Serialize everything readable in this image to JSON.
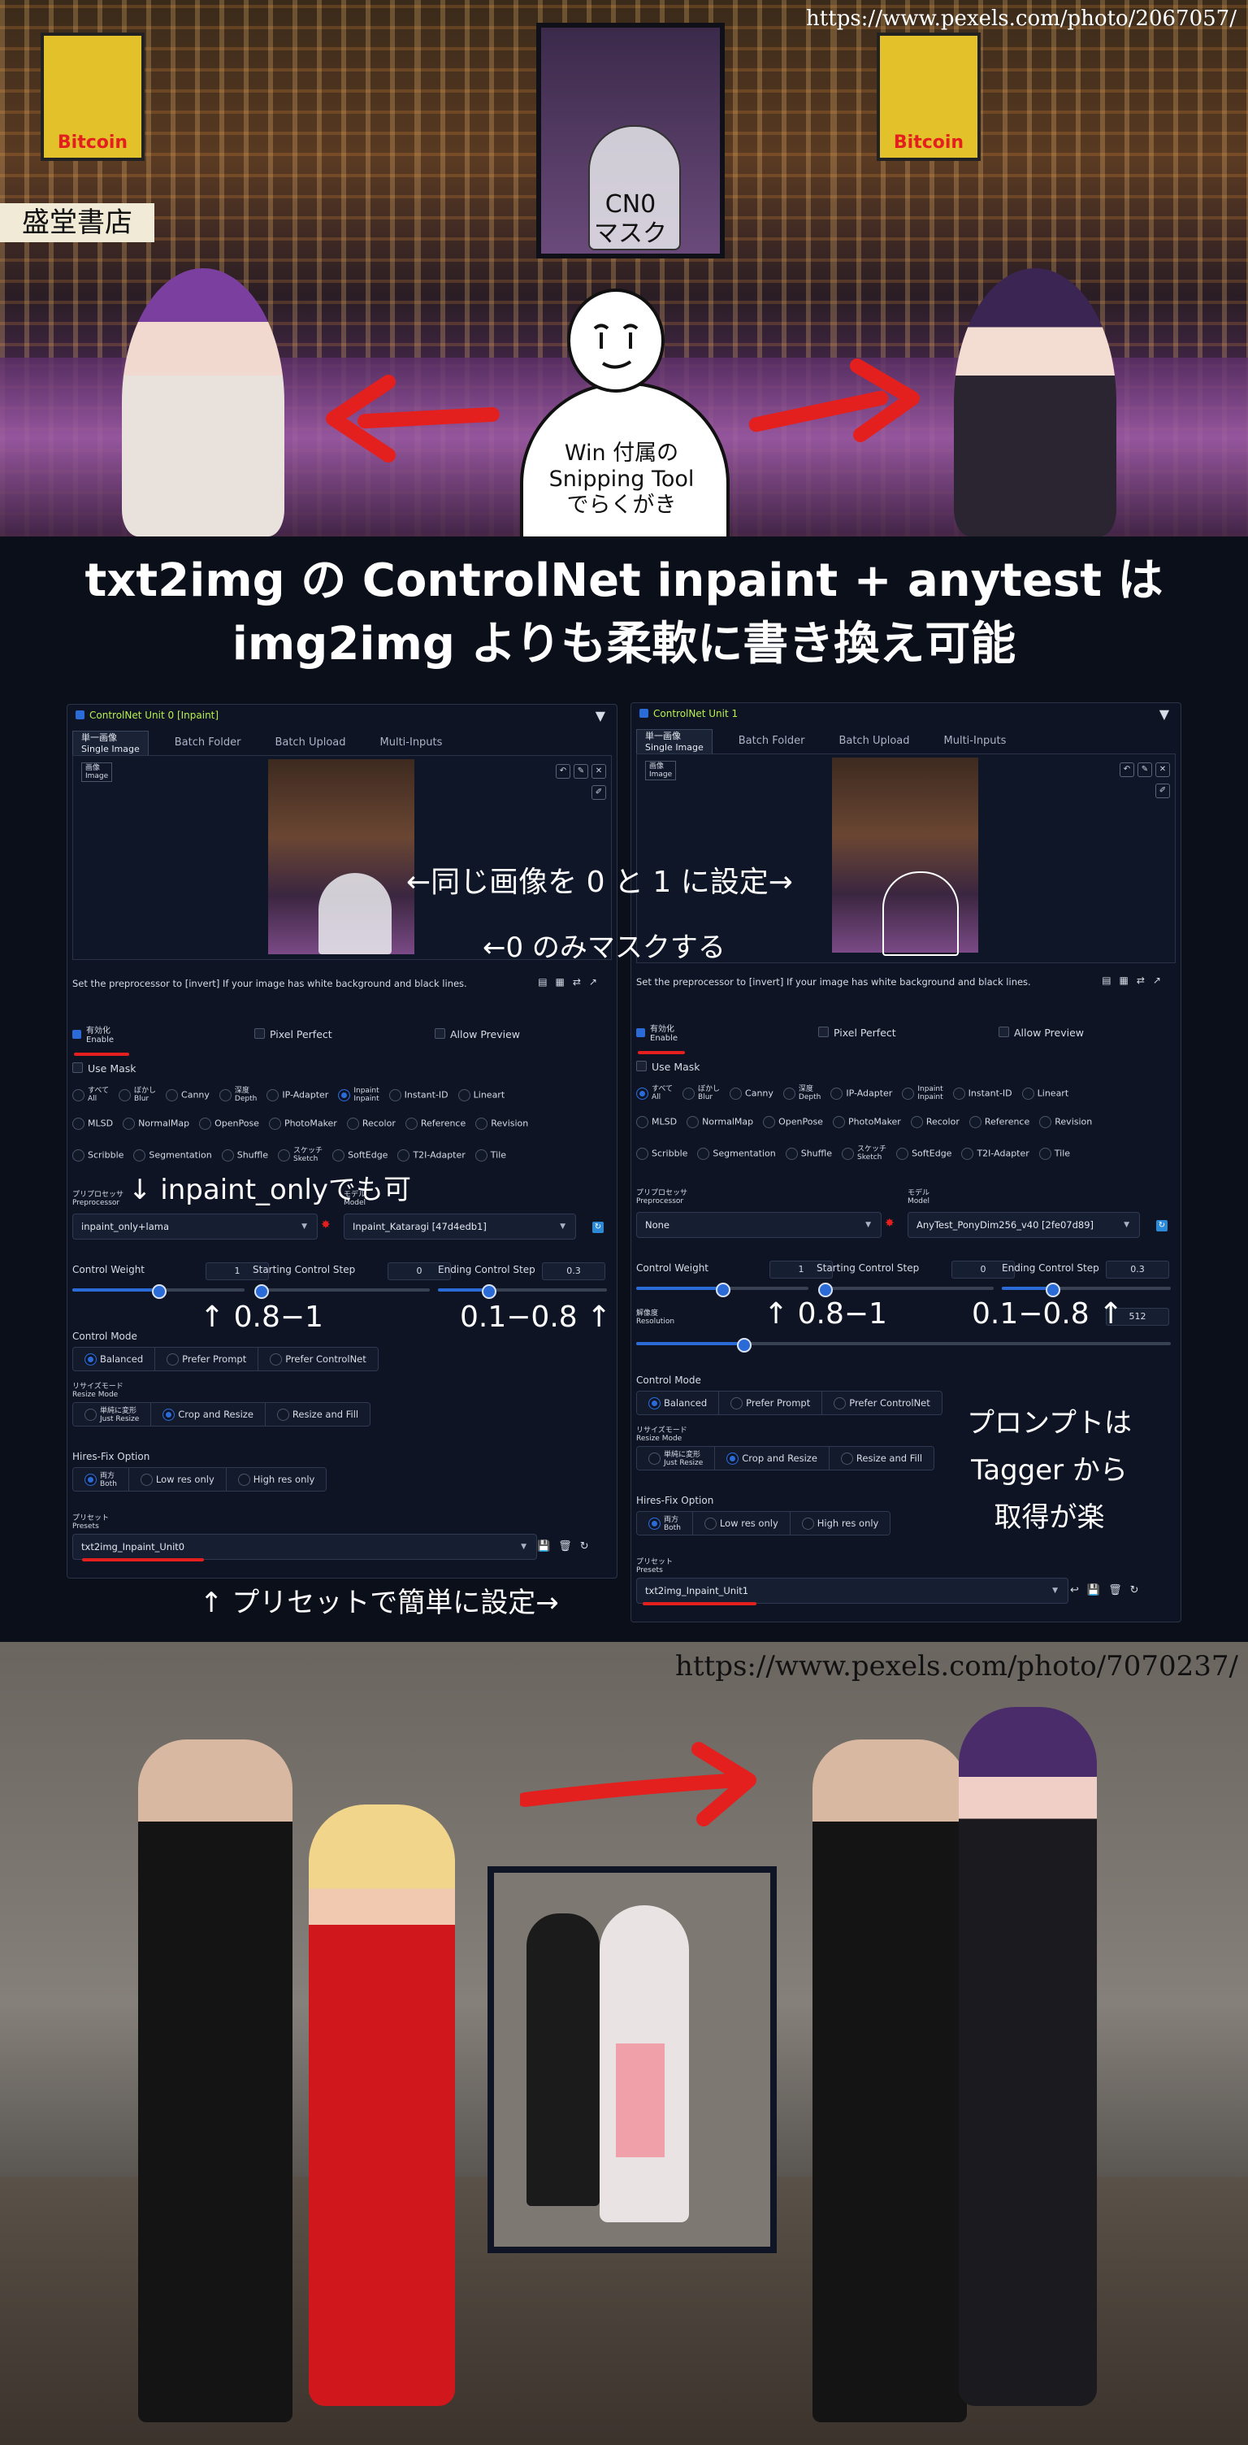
{
  "top_photo": {
    "source_url": "https://www.pexels.com/photo/2067057/",
    "billboard_text": "Bitcoin",
    "sign_text": "盛堂書店",
    "mask_label": "CN0\nマスク",
    "doodle_caption": "Win 付属の\nSnipping Tool\nでらくがき"
  },
  "title": {
    "line1": "txt2img の ControlNet inpaint + anytest は",
    "line2": "img2img よりも柔軟に書き換え可能"
  },
  "unit0": {
    "header": "ControlNet Unit 0 [Inpaint]",
    "tabs": [
      "単一画像\nSingle Image",
      "Batch Folder",
      "Batch Upload",
      "Multi-Inputs"
    ],
    "image_label": "画像\nImage",
    "hint": "Set the preprocessor to [invert] If your image has white background and black lines.",
    "enable": "有効化\nEnable",
    "pixel_perfect": "Pixel Perfect",
    "allow_preview": "Allow Preview",
    "use_mask": "Use Mask",
    "control_types_row1": [
      "すべて\nAll",
      "ぼかし\nBlur",
      "Canny",
      "深度\nDepth",
      "IP-Adapter",
      "Inpaint\nInpaint",
      "Instant-ID",
      "Lineart"
    ],
    "control_types_row2": [
      "MLSD",
      "NormalMap",
      "OpenPose",
      "PhotoMaker",
      "Recolor",
      "Reference",
      "Revision"
    ],
    "control_types_row3": [
      "Scribble",
      "Segmentation",
      "Shuffle",
      "スケッチ\nSketch",
      "SoftEdge",
      "T2I-Adapter",
      "Tile"
    ],
    "selected_type": "Inpaint\nInpaint",
    "preprocessor_label": "プリプロセッサ\nPreprocessor",
    "preprocessor": "inpaint_only+lama",
    "model_label": "モデル\nModel",
    "model": "Inpaint_Kataragi [47d4edb1]",
    "control_weight_label": "Control Weight",
    "control_weight": "1",
    "start_step_label": "Starting Control Step",
    "start_step": "0",
    "end_step_label": "Ending Control Step",
    "end_step": "0.3",
    "weight_fill": 0.5,
    "start_fill": 0.0,
    "end_fill": 0.3,
    "control_mode_label": "Control Mode",
    "control_modes": [
      "Balanced",
      "Prefer Prompt",
      "Prefer ControlNet"
    ],
    "resize_mode_label": "リサイズモード\nResize Mode",
    "resize_modes": [
      "単純に変形\nJust Resize",
      "Crop and Resize",
      "Resize and Fill"
    ],
    "hires_label": "Hires-Fix Option",
    "hires_options": [
      "両方\nBoth",
      "Low res only",
      "High res only"
    ],
    "presets_label": "プリセット\nPresets",
    "preset": "txt2img_Inpaint_Unit0"
  },
  "unit1": {
    "header": "ControlNet Unit 1",
    "tabs": [
      "単一画像\nSingle Image",
      "Batch Folder",
      "Batch Upload",
      "Multi-Inputs"
    ],
    "image_label": "画像\nImage",
    "hint": "Set the preprocessor to [invert] If your image has white background and black lines.",
    "enable": "有効化\nEnable",
    "pixel_perfect": "Pixel Perfect",
    "allow_preview": "Allow Preview",
    "use_mask": "Use Mask",
    "control_types_row1": [
      "すべて\nAll",
      "ぼかし\nBlur",
      "Canny",
      "深度\nDepth",
      "IP-Adapter",
      "Inpaint\nInpaint",
      "Instant-ID",
      "Lineart"
    ],
    "control_types_row2": [
      "MLSD",
      "NormalMap",
      "OpenPose",
      "PhotoMaker",
      "Recolor",
      "Reference",
      "Revision"
    ],
    "control_types_row3": [
      "Scribble",
      "Segmentation",
      "Shuffle",
      "スケッチ\nSketch",
      "SoftEdge",
      "T2I-Adapter",
      "Tile"
    ],
    "selected_type": "すべて\nAll",
    "preprocessor_label": "プリプロセッサ\nPreprocessor",
    "preprocessor": "None",
    "model_label": "モデル\nModel",
    "model": "AnyTest_PonyDim256_v40 [2fe07d89]",
    "control_weight_label": "Control Weight",
    "control_weight": "1",
    "start_step_label": "Starting Control Step",
    "start_step": "0",
    "end_step_label": "Ending Control Step",
    "end_step": "0.3",
    "weight_fill": 0.5,
    "start_fill": 0.0,
    "end_fill": 0.3,
    "resolution_label": "解像度\nResolution",
    "resolution": "512",
    "resolution_fill": 0.2,
    "control_mode_label": "Control Mode",
    "control_modes": [
      "Balanced",
      "Prefer Prompt",
      "Prefer ControlNet"
    ],
    "resize_mode_label": "リサイズモード\nResize Mode",
    "resize_modes": [
      "単純に変形\nJust Resize",
      "Crop and Resize",
      "Resize and Fill"
    ],
    "hires_label": "Hires-Fix Option",
    "hires_options": [
      "両方\nBoth",
      "Low res only",
      "High res only"
    ],
    "presets_label": "プリセット\nPresets",
    "preset": "txt2img_Inpaint_Unit1"
  },
  "annotations": {
    "same_image": "←同じ画像を 0 と 1 に設定→",
    "mask_only_0": "←0 のみマスクする",
    "inpaint_only": "↓ inpaint_onlyでも可",
    "weight0": "↑ 0.8−1",
    "steps0": "0.1−0.8 ↑",
    "weight1": "↑ 0.8−1",
    "steps1": "0.1−0.8 ↑",
    "prompt_tip": "プロンプトは\nTagger から\n取得が楽",
    "preset_tip": "↑ プリセットで簡単に設定→"
  },
  "bottom_photo": {
    "source_url": "https://www.pexels.com/photo/7070237/"
  },
  "colors": {
    "accent_red": "#e3201e",
    "enable_green": "#b7f04a",
    "radio_blue": "#2b6bd8"
  }
}
